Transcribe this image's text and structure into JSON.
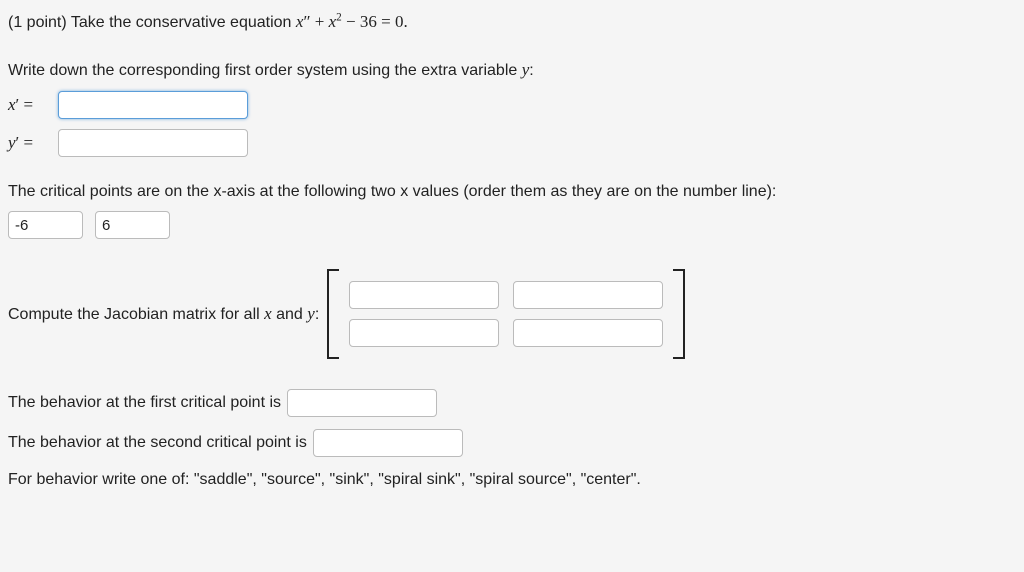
{
  "intro": "(1 point) Take the conservative equation ",
  "equation_parts": {
    "x": "x",
    "dblprime": "″",
    "plus": " + ",
    "sq": "2",
    "minus36eq0": " − 36 = 0."
  },
  "system_prompt": "Write down the corresponding first order system using the extra variable ",
  "system_var": "y",
  "colon": ":",
  "xprime_label_x": "x",
  "yprime_label_y": "y",
  "prime_sym": "′",
  "equals": " = ",
  "xprime_value": "",
  "yprime_value": "",
  "critical_prompt": "The critical points are on the x-axis at the following two x values (order them as they are on the number line):",
  "cp1": "-6",
  "cp2": "6",
  "jacobian_prompt_a": "Compute the Jacobian matrix for all ",
  "jacobian_prompt_b": " and ",
  "jacobian_end": ":",
  "jac": {
    "r1c1": "",
    "r1c2": "",
    "r2c1": "",
    "r2c2": ""
  },
  "behavior1_label": "The behavior at the first critical point is",
  "behavior2_label": "The behavior at the second critical point is",
  "behavior1_value": "",
  "behavior2_value": "",
  "behavior_hint": "For behavior write one of: \"saddle\", \"source\", \"sink\", \"spiral sink\", \"spiral source\", \"center\"."
}
